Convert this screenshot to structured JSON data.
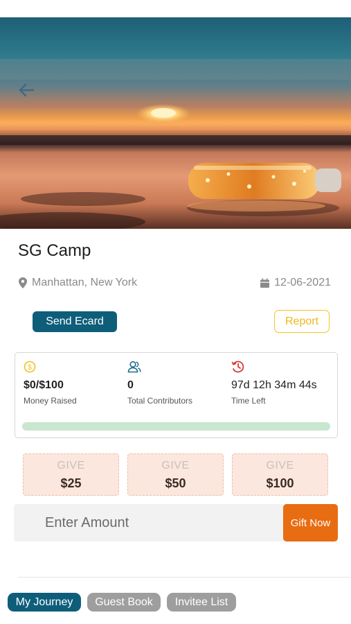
{
  "campaign": {
    "title": "SG Camp",
    "location": "Manhattan, New York",
    "date": "12-06-2021"
  },
  "actions": {
    "send_ecard": "Send Ecard",
    "report": "Report"
  },
  "stats": {
    "money": {
      "value": "$0/$100",
      "label": "Money Raised",
      "icon": "coin-icon"
    },
    "contributors": {
      "value": "0",
      "label": "Total Contributors",
      "icon": "users-icon"
    },
    "time_left": {
      "value": "97d 12h 34m 44s",
      "label": "Time Left",
      "icon": "clock-history-icon"
    },
    "progress_percent": 0
  },
  "give_options": [
    {
      "label": "GIVE",
      "amount": "$25"
    },
    {
      "label": "GIVE",
      "amount": "$50"
    },
    {
      "label": "GIVE",
      "amount": "$100"
    }
  ],
  "amount": {
    "placeholder": "Enter Amount",
    "button": "Gift Now"
  },
  "tabs": [
    {
      "label": "My Journey",
      "active": true
    },
    {
      "label": "Guest Book",
      "active": false
    },
    {
      "label": "Invitee List",
      "active": false
    }
  ],
  "colors": {
    "primary": "#0e5e7a",
    "accent_orange": "#e86c12",
    "report_yellow": "#f5c31a",
    "give_bg": "#fbe7dd",
    "progress_track": "#c9e6d0"
  }
}
